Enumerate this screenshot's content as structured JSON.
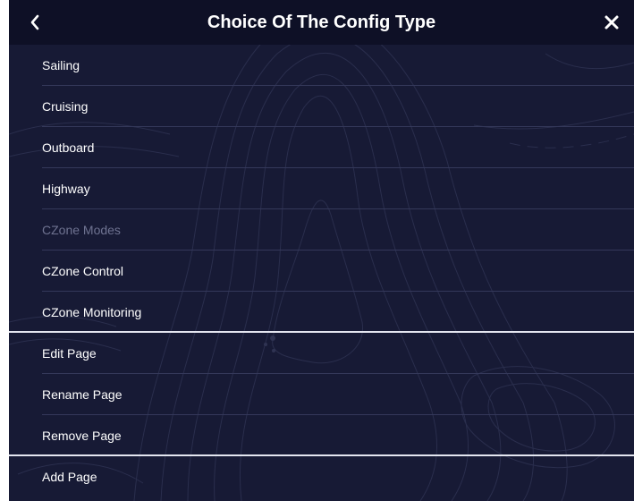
{
  "header": {
    "title": "Choice Of The Config Type",
    "back_icon": "chevron-left-icon",
    "close_icon": "close-icon"
  },
  "colors": {
    "panel_background": "#171a35",
    "header_background": "#0e1026",
    "text": "#ffffff",
    "disabled_text": "#6f7391",
    "divider": "#34385a",
    "section_divider": "#e4e6f0"
  },
  "menu": {
    "items": [
      {
        "label": "Sailing",
        "enabled": true
      },
      {
        "label": "Cruising",
        "enabled": true
      },
      {
        "label": "Outboard",
        "enabled": true
      },
      {
        "label": "Highway",
        "enabled": true
      },
      {
        "label": "CZone Modes",
        "enabled": false
      },
      {
        "label": "CZone Control",
        "enabled": true
      },
      {
        "label": "CZone Monitoring",
        "enabled": true
      },
      {
        "label": "Edit Page",
        "enabled": true
      },
      {
        "label": "Rename Page",
        "enabled": true
      },
      {
        "label": "Remove Page",
        "enabled": true
      },
      {
        "label": "Add Page",
        "enabled": true
      }
    ]
  }
}
